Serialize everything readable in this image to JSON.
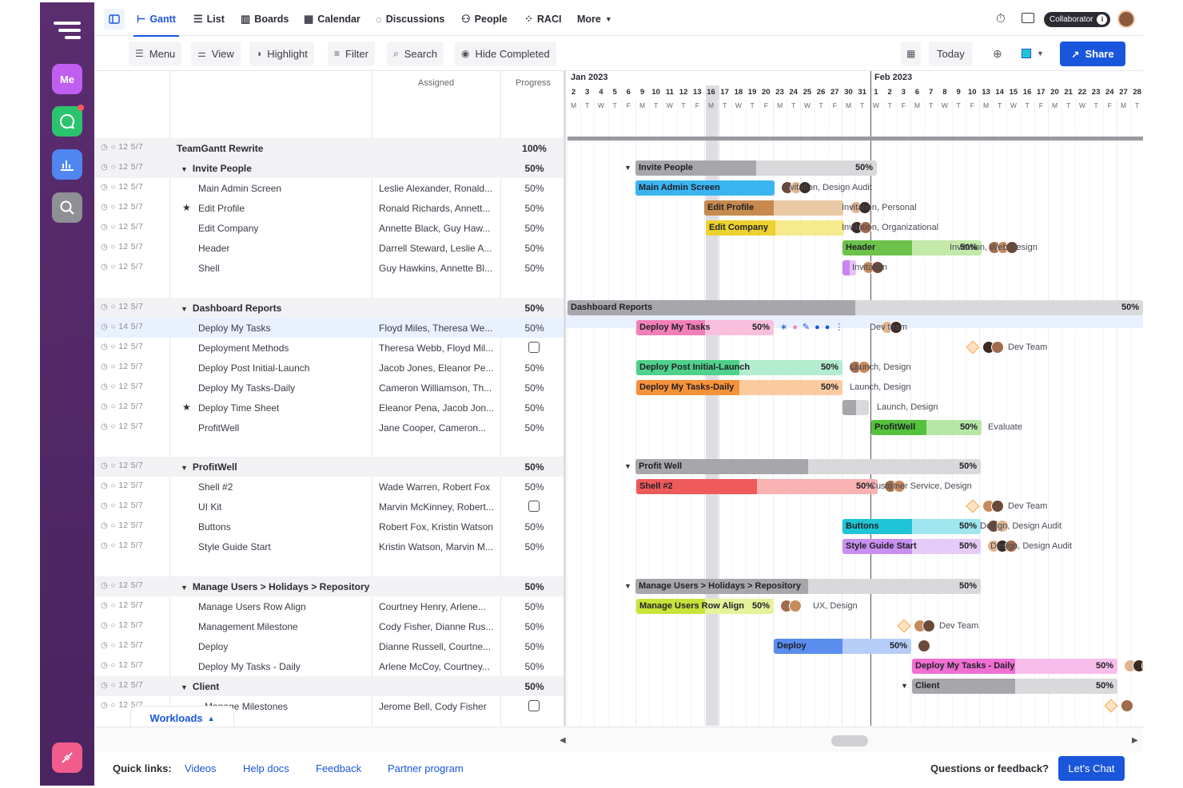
{
  "rail": {
    "me_label": "Me"
  },
  "tabs": [
    {
      "label": "Gantt",
      "icon": "gantt-icon"
    },
    {
      "label": "List",
      "icon": "list-icon"
    },
    {
      "label": "Boards",
      "icon": "boards-icon"
    },
    {
      "label": "Calendar",
      "icon": "calendar-icon"
    },
    {
      "label": "Discussions",
      "icon": "discussions-icon"
    },
    {
      "label": "People",
      "icon": "people-icon"
    },
    {
      "label": "RACI",
      "icon": "raci-icon"
    },
    {
      "label": "More",
      "icon": "chevron-down-icon"
    }
  ],
  "topbar": {
    "role_badge": "Collaborator"
  },
  "toolbar": {
    "menu": "Menu",
    "view": "View",
    "highlight": "Highlight",
    "filter": "Filter",
    "search": "Search",
    "hide_completed": "Hide Completed",
    "today": "Today",
    "share": "Share"
  },
  "columns": {
    "assigned": "Assigned",
    "progress": "Progress"
  },
  "rows": [
    {
      "name": "TeamGantt Rewrite",
      "meta": "12 5/7",
      "assigned": "",
      "progress": "100%",
      "type": "group",
      "indent": 0
    },
    {
      "name": "Invite People",
      "meta": "12 5/7",
      "assigned": "",
      "progress": "50%",
      "type": "group",
      "indent": 1
    },
    {
      "name": "Main Admin Screen",
      "meta": "12 5/7",
      "assigned": "Leslie Alexander, Ronald...",
      "progress": "50%",
      "type": "task",
      "indent": 2
    },
    {
      "name": "Edit Profile",
      "meta": "12 5/7",
      "assigned": "Ronald Richards, Annett...",
      "progress": "50%",
      "type": "task",
      "indent": 2,
      "star": true
    },
    {
      "name": "Edit Company",
      "meta": "12 5/7",
      "assigned": "Annette Black, Guy Haw...",
      "progress": "50%",
      "type": "task",
      "indent": 2
    },
    {
      "name": "Header",
      "meta": "12 5/7",
      "assigned": "Darrell Steward, Leslie A...",
      "progress": "50%",
      "type": "task",
      "indent": 2
    },
    {
      "name": "Shell",
      "meta": "12 5/7",
      "assigned": "Guy Hawkins, Annette Bl...",
      "progress": "50%",
      "type": "task",
      "indent": 2
    },
    {
      "name": "Dashboard Reports",
      "meta": "12 5/7",
      "assigned": "",
      "progress": "50%",
      "type": "group",
      "indent": 1
    },
    {
      "name": "Deploy My Tasks",
      "meta": "14 5/7",
      "assigned": "Floyd Miles, Theresa We...",
      "progress": "50%",
      "type": "task",
      "indent": 2,
      "selected": true
    },
    {
      "name": "Deployment Methods",
      "meta": "12 5/7",
      "assigned": "Theresa Webb, Floyd Mil...",
      "progress": "",
      "type": "milestone",
      "indent": 2
    },
    {
      "name": "Deploy Post Initial-Launch",
      "meta": "12 5/7",
      "assigned": "Jacob Jones, Eleanor Pe...",
      "progress": "50%",
      "type": "task",
      "indent": 2
    },
    {
      "name": "Deploy My Tasks-Daily",
      "meta": "12 5/7",
      "assigned": "Cameron Williamson, Th...",
      "progress": "50%",
      "type": "task",
      "indent": 2
    },
    {
      "name": "Deploy Time Sheet",
      "meta": "12 5/7",
      "assigned": "Eleanor Pena, Jacob Jon...",
      "progress": "50%",
      "type": "task",
      "indent": 2,
      "star": true
    },
    {
      "name": "ProfitWell",
      "meta": "12 5/7",
      "assigned": "Jane Cooper, Cameron...",
      "progress": "50%",
      "type": "task",
      "indent": 2
    },
    {
      "name": "ProfitWell",
      "meta": "12 5/7",
      "assigned": "",
      "progress": "50%",
      "type": "group",
      "indent": 1
    },
    {
      "name": "Shell #2",
      "meta": "12 5/7",
      "assigned": "Wade Warren, Robert Fox",
      "progress": "50%",
      "type": "task",
      "indent": 2
    },
    {
      "name": "UI Kit",
      "meta": "12 5/7",
      "assigned": "Marvin McKinney, Robert...",
      "progress": "",
      "type": "milestone",
      "indent": 2
    },
    {
      "name": "Buttons",
      "meta": "12 5/7",
      "assigned": "Robert Fox, Kristin Watson",
      "progress": "50%",
      "type": "task",
      "indent": 2
    },
    {
      "name": "Style Guide Start",
      "meta": "12 5/7",
      "assigned": "Kristin Watson, Marvin M...",
      "progress": "50%",
      "type": "task",
      "indent": 2
    },
    {
      "name": "Manage Users > Holidays > Repository",
      "meta": "12 5/7",
      "assigned": "",
      "progress": "50%",
      "type": "group",
      "indent": 1
    },
    {
      "name": "Manage Users Row Align",
      "meta": "12 5/7",
      "assigned": "Courtney Henry, Arlene...",
      "progress": "50%",
      "type": "task",
      "indent": 2
    },
    {
      "name": "Management Milestone",
      "meta": "12 5/7",
      "assigned": "Cody Fisher, Dianne Rus...",
      "progress": "50%",
      "type": "task",
      "indent": 2
    },
    {
      "name": "Deploy",
      "meta": "12 5/7",
      "assigned": "Dianne Russell, Courtne...",
      "progress": "50%",
      "type": "task",
      "indent": 2
    },
    {
      "name": "Deploy My Tasks - Daily",
      "meta": "12 5/7",
      "assigned": "Arlene McCoy, Courtney...",
      "progress": "50%",
      "type": "task",
      "indent": 2
    },
    {
      "name": "Client",
      "meta": "12 5/7",
      "assigned": "",
      "progress": "50%",
      "type": "group",
      "indent": 1
    },
    {
      "name": "Manage Milestones",
      "meta": "12 5/7",
      "assigned": "Jerome Bell, Cody Fisher",
      "progress": "",
      "type": "milestone",
      "indent": 3
    }
  ],
  "timeline": {
    "months": [
      "Jan 2023",
      "Feb 2023"
    ],
    "days": [
      "2",
      "3",
      "4",
      "5",
      "6",
      "9",
      "10",
      "11",
      "12",
      "13",
      "16",
      "17",
      "18",
      "19",
      "20",
      "23",
      "24",
      "25",
      "26",
      "27",
      "30",
      "31",
      "1",
      "2",
      "3",
      "6",
      "7",
      "8",
      "9",
      "10",
      "13",
      "14",
      "15",
      "16",
      "17",
      "20",
      "21",
      "22",
      "23",
      "24",
      "27",
      "28"
    ],
    "weekdays": [
      "M",
      "T",
      "W",
      "T",
      "F",
      "M",
      "T",
      "W",
      "T",
      "F",
      "M",
      "T",
      "W",
      "T",
      "F",
      "M",
      "T",
      "W",
      "T",
      "F",
      "M",
      "T",
      "W",
      "T",
      "F",
      "M",
      "T",
      "W",
      "T",
      "F",
      "M",
      "T",
      "W",
      "T",
      "F",
      "M",
      "T",
      "W",
      "T",
      "F",
      "M",
      "T"
    ]
  },
  "bars": [
    {
      "label": "Invite People",
      "pct": "50%",
      "color": "#a6a6ab",
      "bg": "#d9d9dc",
      "note": ""
    },
    {
      "label": "Main Admin Screen",
      "pct": "",
      "color": "#3bb4f2",
      "bg": "#a9def9",
      "note": "Invitation, Design Audit"
    },
    {
      "label": "Edit Profile",
      "pct": "",
      "color": "#c68a4e",
      "bg": "#e9c9a6",
      "note": "Invitation, Personal"
    },
    {
      "label": "Edit Company",
      "pct": "",
      "color": "#ecd12f",
      "bg": "#f6e98e",
      "note": "Invitation, Organizational"
    },
    {
      "label": "Header",
      "pct": "50%",
      "color": "#6cc24a",
      "bg": "#c3e9a9",
      "note": "Invitation, Web Design"
    },
    {
      "label": "",
      "pct": "",
      "color": "#c985f1",
      "bg": "#e5c2fa",
      "note": "Invitation"
    },
    {
      "label": "Dashboard Reports",
      "pct": "50%",
      "color": "#a6a6ab",
      "bg": "#d9d9dc",
      "note": ""
    },
    {
      "label": "Deploy My Tasks",
      "pct": "50%",
      "color": "#f27fb8",
      "bg": "#f9bfdc",
      "note": "Dev team"
    },
    {
      "label": "",
      "pct": "",
      "color": "",
      "bg": "",
      "note": "Dev Team"
    },
    {
      "label": "Deploy Post Initial-Launch",
      "pct": "50%",
      "color": "#4fd18b",
      "bg": "#b3ecce",
      "note": "Launch, Design"
    },
    {
      "label": "Deploy My Tasks-Daily",
      "pct": "50%",
      "color": "#f7923a",
      "bg": "#fbcb9f",
      "note": "Launch, Design"
    },
    {
      "label": "",
      "pct": "",
      "color": "#a6a6ab",
      "bg": "#d9d9dc",
      "note": "Launch, Design"
    },
    {
      "label": "ProfitWell",
      "pct": "50%",
      "color": "#54c23c",
      "bg": "#b6e7a6",
      "note": "Evaluate"
    },
    {
      "label": "Profit Well",
      "pct": "50%",
      "color": "#a6a6ab",
      "bg": "#d9d9dc",
      "note": ""
    },
    {
      "label": "Shell #2",
      "pct": "50%",
      "color": "#ef5a5a",
      "bg": "#f8b2b2",
      "note": "Customer Service, Design"
    },
    {
      "label": "",
      "pct": "",
      "color": "",
      "bg": "",
      "note": "Dev Team"
    },
    {
      "label": "Buttons",
      "pct": "50%",
      "color": "#1fc5d6",
      "bg": "#9fe6ee",
      "note": "Design, Design Audit"
    },
    {
      "label": "Style Guide Start",
      "pct": "50%",
      "color": "#c98ff0",
      "bg": "#e6cbf8",
      "note": "Design, Design Audit"
    },
    {
      "label": "Manage Users > Holidays > Repository",
      "pct": "50%",
      "color": "#a6a6ab",
      "bg": "#d9d9dc",
      "note": ""
    },
    {
      "label": "Manage Users Row Align",
      "pct": "50%",
      "color": "#c9e339",
      "bg": "#e6f29a",
      "note": "UX, Design"
    },
    {
      "label": "",
      "pct": "",
      "color": "",
      "bg": "",
      "note": "Dev Team"
    },
    {
      "label": "Deploy",
      "pct": "50%",
      "color": "#5b8def",
      "bg": "#b6cdf8",
      "note": ""
    },
    {
      "label": "Deploy My Tasks - Daily",
      "pct": "50%",
      "color": "#ef6fd2",
      "bg": "#f8bdeb",
      "note": ""
    },
    {
      "label": "Client",
      "pct": "50%",
      "color": "#a6a6ab",
      "bg": "#d9d9dc",
      "note": ""
    },
    {
      "label": "",
      "pct": "",
      "color": "",
      "bg": "",
      "note": ""
    }
  ],
  "workloads": "Workloads",
  "footer": {
    "quick_links": "Quick links:",
    "links": [
      "Videos",
      "Help docs",
      "Feedback",
      "Partner program"
    ],
    "question": "Questions or feedback?",
    "chat": "Let's Chat"
  },
  "colors": {
    "accent": "#1a56db",
    "rail": "#4a2360"
  }
}
